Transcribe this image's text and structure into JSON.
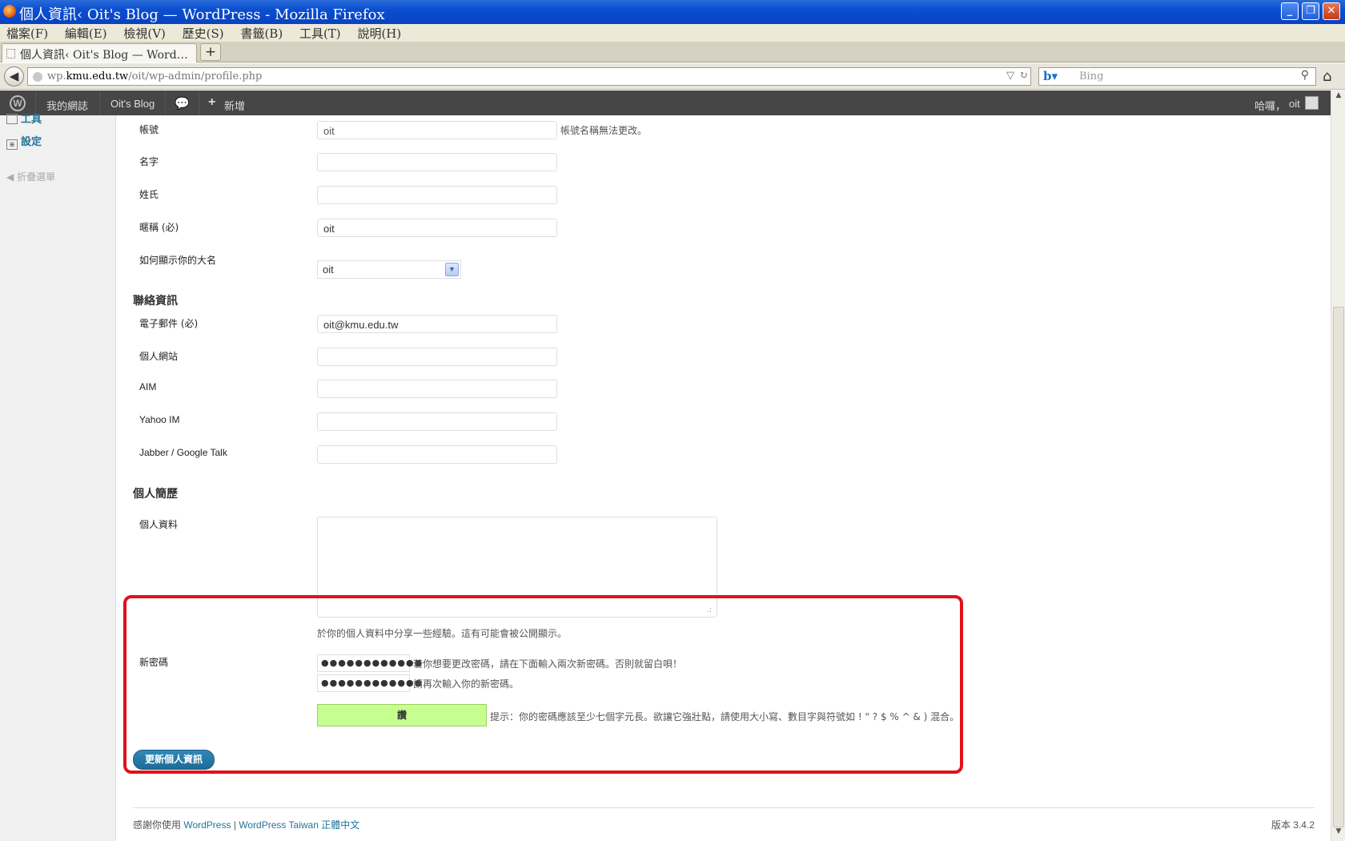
{
  "window": {
    "title": "個人資訊‹ Oit's Blog — WordPress - Mozilla Firefox",
    "minimize": "_",
    "maximize": "❐",
    "close": "✕"
  },
  "menu": [
    "檔案(F)",
    "編輯(E)",
    "檢視(V)",
    "歷史(S)",
    "書籤(B)",
    "工具(T)",
    "說明(H)"
  ],
  "tab": {
    "title": "個人資訊‹ Oit's Blog — Word…",
    "new_tab": "+"
  },
  "nav": {
    "url_prefix": "wp.",
    "url_domain": "kmu.edu.tw",
    "url_path": "/oit/wp-admin/profile.php",
    "search_placeholder": "Bing"
  },
  "adminbar": {
    "my_sites": "我的網誌",
    "blog_name": "Oit's Blog",
    "new": "新增",
    "greeting": "哈囉，",
    "user": "oit"
  },
  "sidebar": {
    "tools": "工具",
    "settings": "設定",
    "collapse": "折疊選單"
  },
  "form": {
    "username_label": "帳號",
    "username_value": "oit",
    "username_note": "帳號名稱無法更改。",
    "first_name_label": "名字",
    "last_name_label": "姓氏",
    "nickname_label": "暱稱 (必)",
    "nickname_value": "oit",
    "display_name_label": "如何顯示你的大名",
    "display_name_value": "oit",
    "contact_heading": "聯絡資訊",
    "email_label": "電子郵件 (必)",
    "email_value": "oit@kmu.edu.tw",
    "website_label": "個人網站",
    "aim_label": "AIM",
    "yahoo_label": "Yahoo IM",
    "jabber_label": "Jabber / Google Talk",
    "about_heading": "個人簡歷",
    "bio_label": "個人資料",
    "bio_note": "於你的個人資料中分享一些經驗。這有可能會被公開顯示。",
    "new_password_label": "新密碼",
    "password1_value": "●●●●●●●●●●●●",
    "password1_note": "若你想要更改密碼，請在下面輸入兩次新密碼。否則就留白唄！",
    "password2_value": "●●●●●●●●●●●●",
    "password2_note": "請再次輸入你的新密碼。",
    "strength_label": "讚",
    "strength_hint": "提示：你的密碼應該至少七個字元長。欲讓它強壯點，請使用大小寫、數目字與符號如 ! \" ? $ % ^ & ) 混合。",
    "update_button": "更新個人資訊"
  },
  "footer": {
    "thanks": "感謝你使用 ",
    "wordpress": "WordPress",
    "sep": " | ",
    "wp_taiwan": "WordPress Taiwan 正體中文",
    "version": "版本 3.4.2"
  }
}
